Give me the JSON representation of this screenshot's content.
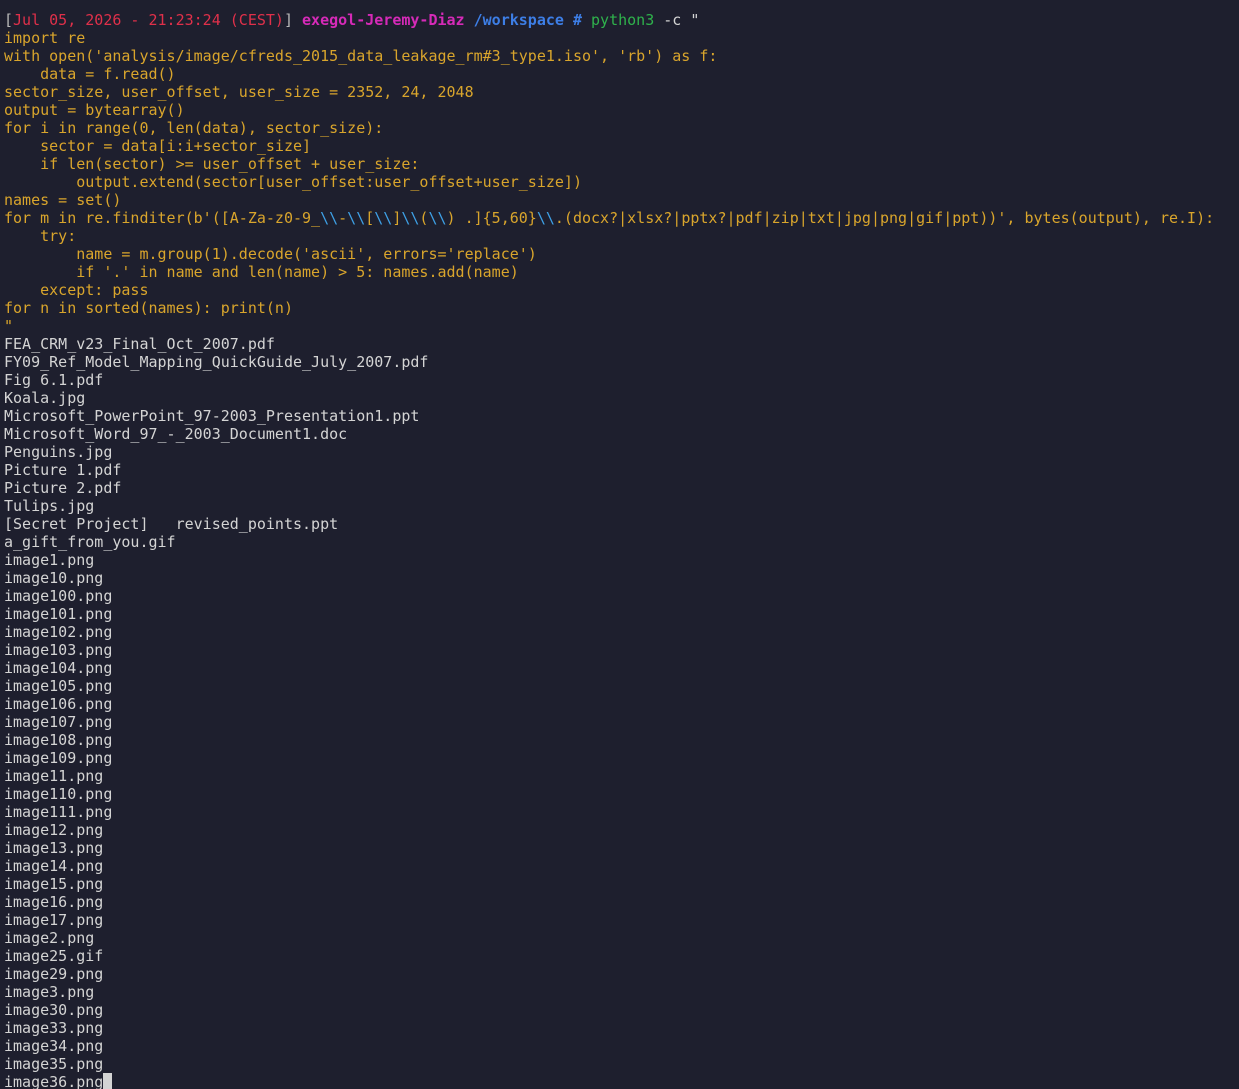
{
  "prompt": {
    "timestamp": "Jul 05, 2026 - 21:23:24 (CEST)",
    "open_bracket": "[",
    "close_bracket": "]",
    "host": "exegol-Jeremy-Diaz",
    "cwd": "/workspace",
    "hash": "#",
    "command": "python3",
    "args": "-c \""
  },
  "code": {
    "l1": "import re",
    "l2": "with open('analysis/image/cfreds_2015_data_leakage_rm#3_type1.iso', 'rb') as f:",
    "l3": "    data = f.read()",
    "l4": "sector_size, user_offset, user_size = 2352, 24, 2048",
    "l5": "output = bytearray()",
    "l6": "for i in range(0, len(data), sector_size):",
    "l7": "    sector = data[i:i+sector_size]",
    "l8": "    if len(sector) >= user_offset + user_size:",
    "l9": "        output.extend(sector[user_offset:user_offset+user_size])",
    "l10": "names = set()",
    "l11": {
      "a": "for m in re.finditer(b'([A-Za-z0-9_",
      "b": "\\\\",
      "c": "-",
      "d": "\\\\",
      "e": "[",
      "f": "\\\\",
      "g": "]",
      "h": "\\\\",
      "i": "(",
      "j": "\\\\",
      "k": ") .]{5,60}",
      "l": "\\\\",
      "m": ".(docx?|xlsx?|pptx?|pdf|zip|txt|jpg|png|gif|ppt))', bytes(output), re.I):"
    },
    "l12": "    try:",
    "l13": "        name = m.group(1).decode('ascii', errors='replace')",
    "l14": "        if '.' in name and len(name) > 5: names.add(name)",
    "l15": "    except: pass",
    "l16": "for n in sorted(names): print(n)",
    "l17": "\""
  },
  "output": [
    "FEA_CRM_v23_Final_Oct_2007.pdf",
    "FY09_Ref_Model_Mapping_QuickGuide_July_2007.pdf",
    "Fig 6.1.pdf",
    "Koala.jpg",
    "Microsoft_PowerPoint_97-2003_Presentation1.ppt",
    "Microsoft_Word_97_-_2003_Document1.doc",
    "Penguins.jpg",
    "Picture 1.pdf",
    "Picture 2.pdf",
    "Tulips.jpg",
    "[Secret Project]   revised_points.ppt",
    "a_gift_from_you.gif",
    "image1.png",
    "image10.png",
    "image100.png",
    "image101.png",
    "image102.png",
    "image103.png",
    "image104.png",
    "image105.png",
    "image106.png",
    "image107.png",
    "image108.png",
    "image109.png",
    "image11.png",
    "image110.png",
    "image111.png",
    "image12.png",
    "image13.png",
    "image14.png",
    "image15.png",
    "image16.png",
    "image17.png",
    "image2.png",
    "image25.gif",
    "image29.png",
    "image3.png",
    "image30.png",
    "image33.png",
    "image34.png",
    "image35.png",
    "image36.png"
  ],
  "colors": {
    "background": "#1e1f2e",
    "timestamp": "#e0304a",
    "host": "#d62ab8",
    "path": "#3d7ee6",
    "command": "#2fb24c",
    "code": "#d9a52c",
    "escape": "#3ea0e6",
    "text": "#d4d4d4"
  }
}
